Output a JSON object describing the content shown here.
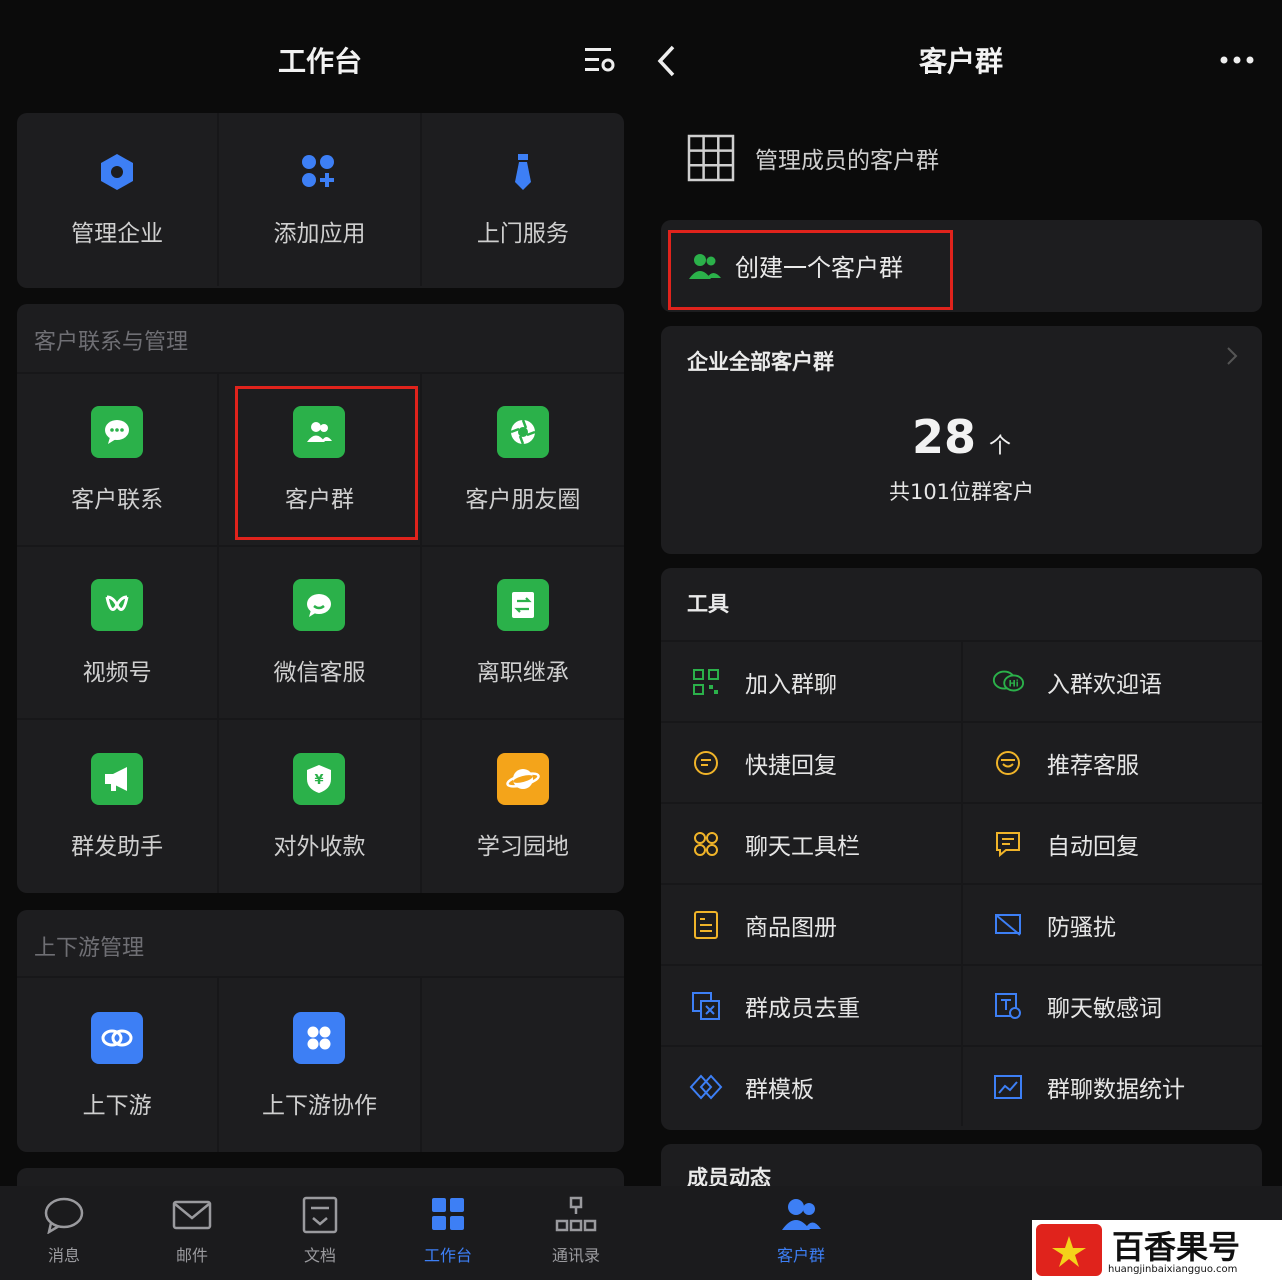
{
  "left": {
    "title": "工作台",
    "top_items": [
      {
        "label": "管理企业",
        "icon": "hexagon-icon"
      },
      {
        "label": "添加应用",
        "icon": "add-apps-icon"
      },
      {
        "label": "上门服务",
        "icon": "tie-icon"
      }
    ],
    "customer_section": {
      "title": "客户联系与管理",
      "items": [
        {
          "label": "客户联系",
          "icon": "chat-bubble-icon"
        },
        {
          "label": "客户群",
          "icon": "group-icon"
        },
        {
          "label": "客户朋友圈",
          "icon": "aperture-icon"
        },
        {
          "label": "视频号",
          "icon": "channels-icon"
        },
        {
          "label": "微信客服",
          "icon": "service-chat-icon"
        },
        {
          "label": "离职继承",
          "icon": "transfer-doc-icon"
        },
        {
          "label": "群发助手",
          "icon": "megaphone-icon"
        },
        {
          "label": "对外收款",
          "icon": "payment-shield-icon"
        },
        {
          "label": "学习园地",
          "icon": "planet-icon"
        }
      ]
    },
    "updown_section": {
      "title": "上下游管理",
      "items": [
        {
          "label": "上下游",
          "icon": "link-icon"
        },
        {
          "label": "上下游协作",
          "icon": "grid-apps-icon"
        }
      ]
    },
    "tabs": [
      {
        "label": "消息",
        "icon": "message-icon"
      },
      {
        "label": "邮件",
        "icon": "mail-icon"
      },
      {
        "label": "文档",
        "icon": "doc-icon"
      },
      {
        "label": "工作台",
        "icon": "workbench-icon"
      },
      {
        "label": "通讯录",
        "icon": "contacts-icon"
      }
    ]
  },
  "right": {
    "title": "客户群",
    "manage_label": "管理成员的客户群",
    "create_label": "创建一个客户群",
    "all_groups": {
      "title": "企业全部客户群",
      "count": "28",
      "unit": "个",
      "subtitle": "共101位群客户"
    },
    "tools": {
      "title": "工具",
      "items": [
        {
          "label": "加入群聊",
          "icon": "qr-code-icon"
        },
        {
          "label": "入群欢迎语",
          "icon": "hi-bubble-icon"
        },
        {
          "label": "快捷回复",
          "icon": "quick-reply-icon"
        },
        {
          "label": "推荐客服",
          "icon": "smile-bubble-icon"
        },
        {
          "label": "聊天工具栏",
          "icon": "toolbar-icon"
        },
        {
          "label": "自动回复",
          "icon": "auto-reply-icon"
        },
        {
          "label": "商品图册",
          "icon": "catalog-icon"
        },
        {
          "label": "防骚扰",
          "icon": "anti-harass-icon"
        },
        {
          "label": "群成员去重",
          "icon": "dedupe-icon"
        },
        {
          "label": "聊天敏感词",
          "icon": "sensitive-word-icon"
        },
        {
          "label": "群模板",
          "icon": "template-icon"
        },
        {
          "label": "群聊数据统计",
          "icon": "stats-icon"
        }
      ]
    },
    "member_activity": "成员动态",
    "tab_active": "客户群"
  },
  "watermark": {
    "name": "百香果号",
    "url": "huangjinbaixiangguo.com"
  },
  "colors": {
    "accent_blue": "#3d7ff5",
    "app_green": "#2bb14a",
    "highlight_red": "#e0231c",
    "tool_yellow": "#f0b429",
    "tool_green": "#2bb14a"
  }
}
